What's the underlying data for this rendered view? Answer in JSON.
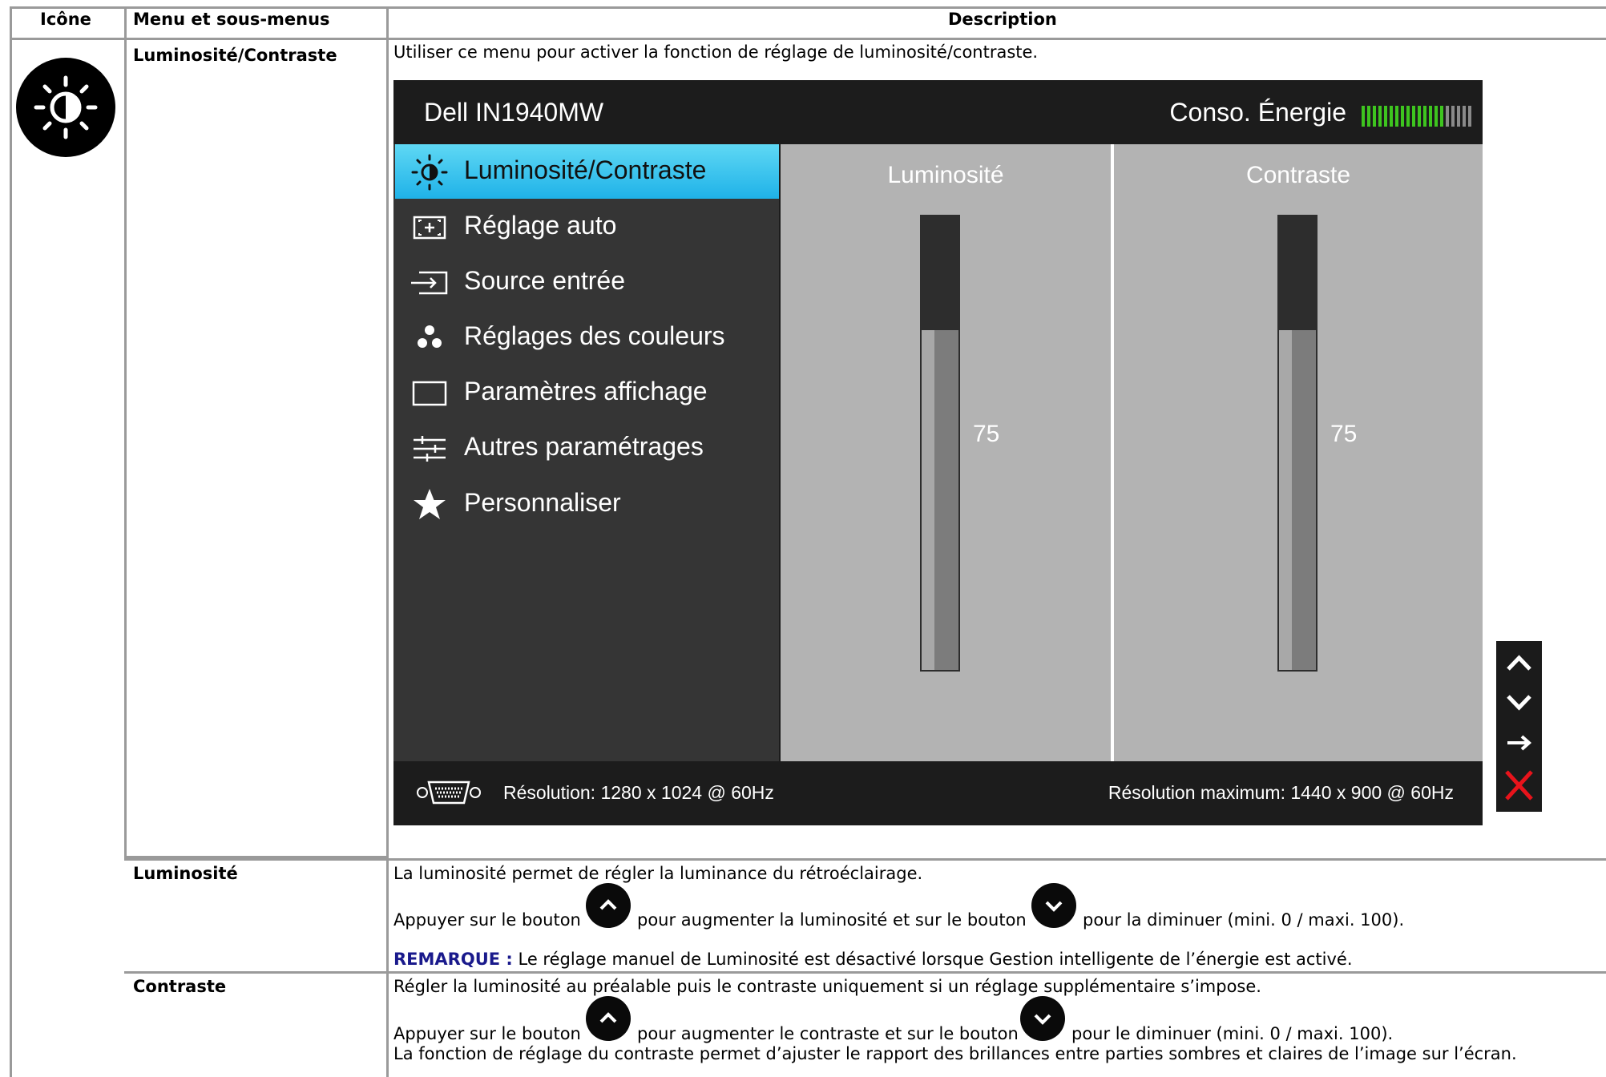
{
  "table": {
    "header": {
      "icon": "Icône",
      "menu": "Menu et sous-menus",
      "description": "Description"
    }
  },
  "brightness_contrast_row": {
    "menu_label": "Luminosité/Contraste",
    "description": "Utiliser ce menu pour activer la fonction de réglage de luminosité/contraste.",
    "icon": "brightness-contrast-icon"
  },
  "osd": {
    "title": "Dell IN1940MW",
    "energy_label": "Conso. Énergie",
    "energy_level": 0.75,
    "menu_items": [
      {
        "label": "Luminosité/Contraste",
        "icon": "brightness-icon",
        "selected": true
      },
      {
        "label": "Réglage auto",
        "icon": "auto-adjust-icon"
      },
      {
        "label": "Source entrée",
        "icon": "input-source-icon"
      },
      {
        "label": "Réglages des couleurs",
        "icon": "color-settings-icon"
      },
      {
        "label": "Paramètres affichage",
        "icon": "display-settings-icon"
      },
      {
        "label": "Autres paramétrages",
        "icon": "other-settings-icon"
      },
      {
        "label": "Personnaliser",
        "icon": "star-icon"
      }
    ],
    "brightness": {
      "label": "Luminosité",
      "value": "75",
      "level": 0.75
    },
    "contrast": {
      "label": "Contraste",
      "value": "75",
      "level": 0.75
    },
    "resolution": "Résolution: 1280 x 1024 @ 60Hz",
    "max_resolution": "Résolution maximum: 1440 x 900 @ 60Hz",
    "nav_buttons": [
      "up-arrow-icon",
      "down-arrow-icon",
      "right-arrow-icon",
      "close-icon"
    ]
  },
  "brightness_row": {
    "menu_label": "Luminosité",
    "line1": "La luminosité permet de régler la luminance du rétroéclairage.",
    "line2_a": "Appuyer sur le bouton",
    "line2_b": "pour augmenter la luminosité et sur le bouton",
    "line2_c": "pour la diminuer (mini. 0 / maxi. 100).",
    "note_label": "REMARQUE :",
    "note_text": "Le réglage manuel de Luminosité est désactivé lorsque Gestion intelligente de l’énergie est activé."
  },
  "contrast_row": {
    "menu_label": "Contraste",
    "line1": "Régler la luminosité au préalable puis le contraste uniquement si un réglage supplémentaire s’impose.",
    "line2_a": "Appuyer sur le bouton",
    "line2_b": "pour augmenter le contraste et sur le bouton",
    "line2_c": "pour le diminuer (mini. 0 / maxi. 100).",
    "line3": "La fonction de réglage du contraste permet d’ajuster le rapport des brillances entre parties sombres et claires de l’image sur l’écran."
  },
  "colors": {
    "note": "#1a1a8c",
    "selected_top": "#5fd8f4",
    "selected_bottom": "#1fb2e8",
    "energy_green": "#3ec51f",
    "close_red": "#e8131b"
  }
}
